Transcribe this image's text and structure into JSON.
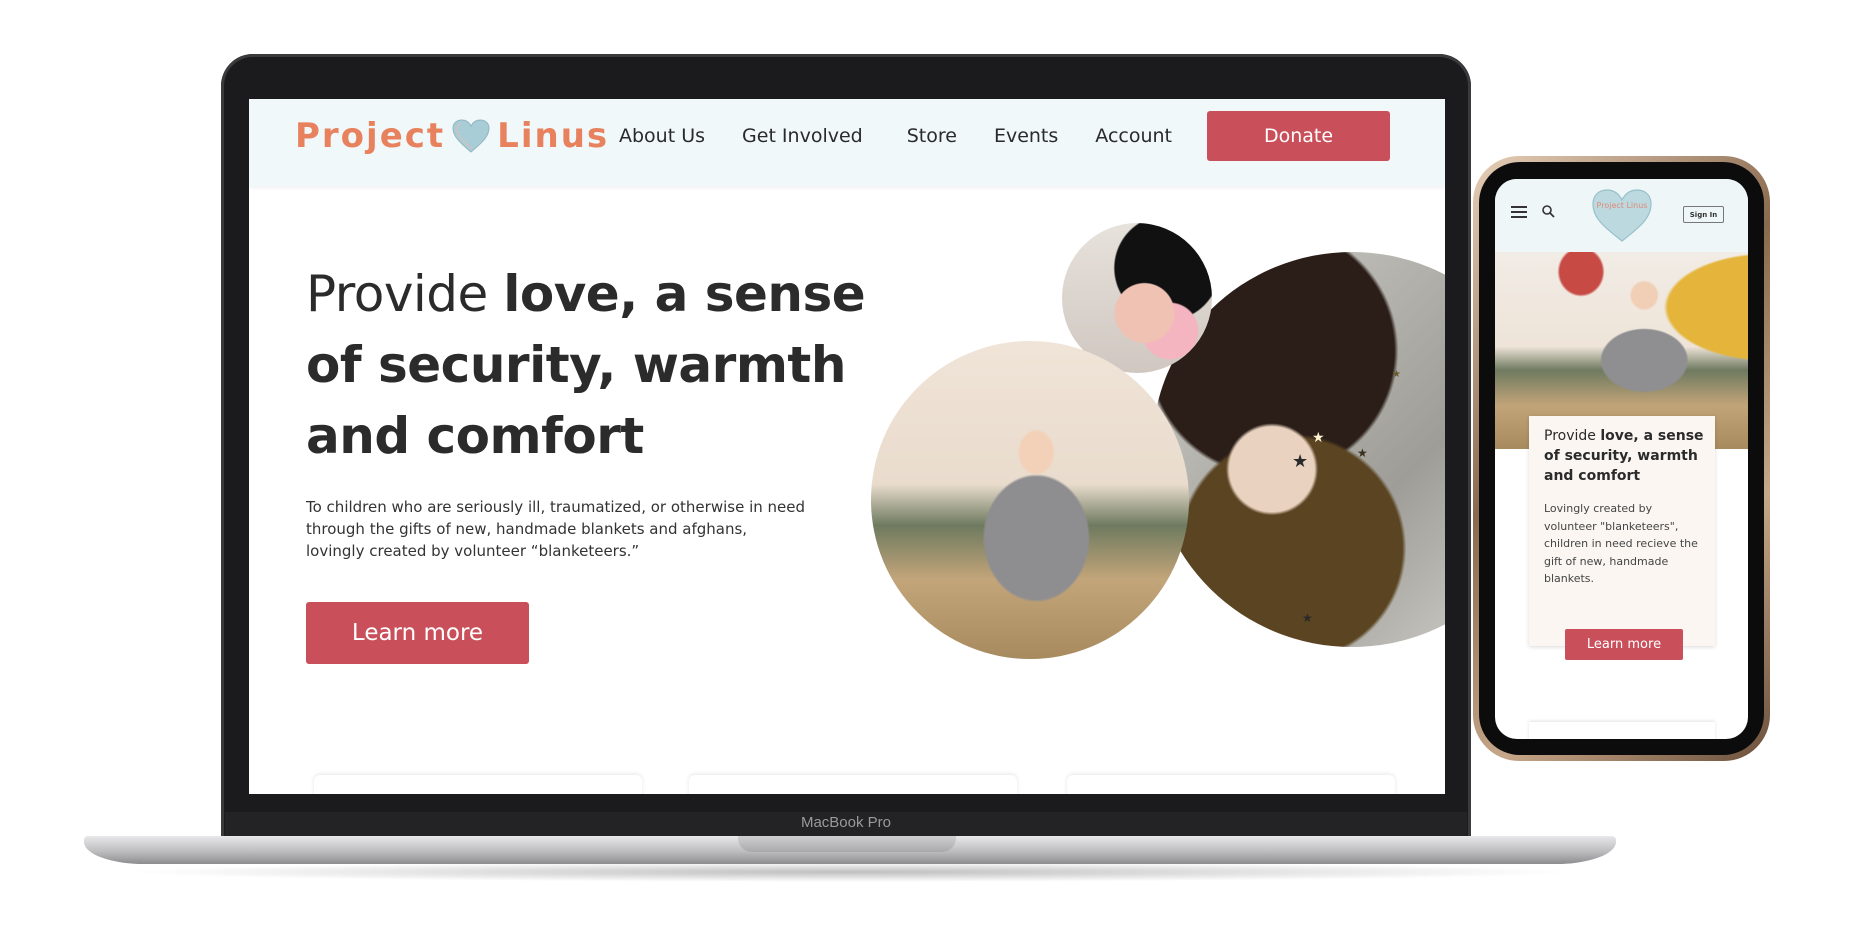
{
  "desktop": {
    "device_label": "MacBook Pro",
    "logo": {
      "left_text": "Project",
      "right_text": "Linus",
      "icon": "heart-icon"
    },
    "nav": {
      "links": [
        "About Us",
        "Get Involved",
        "Store",
        "Events",
        "Account"
      ],
      "donate_label": "Donate"
    },
    "hero": {
      "title_light": "Provide ",
      "title_bold": "love, a sense of security, warmth and comfort",
      "description": "To children who are seriously ill, traumatized, or otherwise in need through the gifts of new, handmade blankets and afghans, lovingly created by volunteer “blanketeers.”",
      "cta_label": "Learn more"
    }
  },
  "mobile": {
    "icons": [
      "menu-icon",
      "search-icon"
    ],
    "logo_text": "Project Linus",
    "signin_label": "Sign In",
    "title_light": "Provide ",
    "title_bold": "love, a sense of security, warmth and comfort",
    "description": "Lovingly created by volunteer \"blanketeers\", children in need recieve the gift of new, handmade blankets.",
    "cta_label": "Learn more"
  },
  "colors": {
    "accent": "#c9505b",
    "logo": "#e8825e",
    "nav_background": "#f1f8fa",
    "text": "#2b2b2b"
  }
}
